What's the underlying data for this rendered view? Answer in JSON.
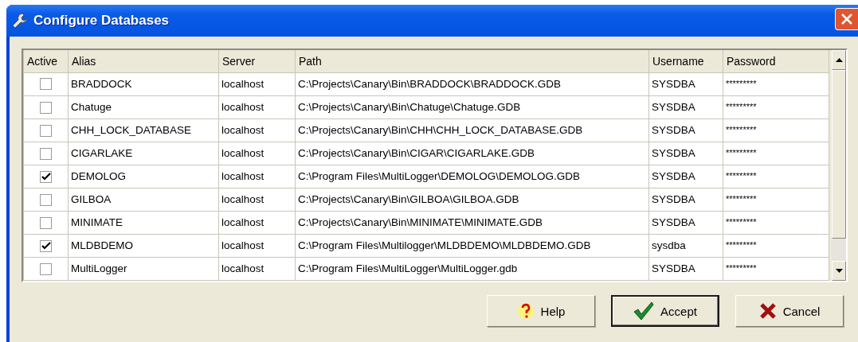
{
  "window": {
    "title": "Configure Databases"
  },
  "table": {
    "columns": [
      "Active",
      "Alias",
      "Server",
      "Path",
      "Username",
      "Password"
    ],
    "rows": [
      {
        "active": false,
        "alias": "BRADDOCK",
        "server": "localhost",
        "path": "C:\\Projects\\Canary\\Bin\\BRADDOCK\\BRADDOCK.GDB",
        "username": "SYSDBA",
        "password": "*********"
      },
      {
        "active": false,
        "alias": "Chatuge",
        "server": "localhost",
        "path": "C:\\Projects\\Canary\\Bin\\Chatuge\\Chatuge.GDB",
        "username": "SYSDBA",
        "password": "*********"
      },
      {
        "active": false,
        "alias": "CHH_LOCK_DATABASE",
        "server": "localhost",
        "path": "C:\\Projects\\Canary\\Bin\\CHH\\CHH_LOCK_DATABASE.GDB",
        "username": "SYSDBA",
        "password": "*********"
      },
      {
        "active": false,
        "alias": "CIGARLAKE",
        "server": "localhost",
        "path": "C:\\Projects\\Canary\\Bin\\CIGAR\\CIGARLAKE.GDB",
        "username": "SYSDBA",
        "password": "*********"
      },
      {
        "active": true,
        "alias": "DEMOLOG",
        "server": "localhost",
        "path": "C:\\Program Files\\MultiLogger\\DEMOLOG\\DEMOLOG.GDB",
        "username": "SYSDBA",
        "password": "*********"
      },
      {
        "active": false,
        "alias": "GILBOA",
        "server": "localhost",
        "path": "C:\\Projects\\Canary\\Bin\\GILBOA\\GILBOA.GDB",
        "username": "SYSDBA",
        "password": "*********"
      },
      {
        "active": false,
        "alias": "MINIMATE",
        "server": "localhost",
        "path": "C:\\Projects\\Canary\\Bin\\MINIMATE\\MINIMATE.GDB",
        "username": "SYSDBA",
        "password": "*********"
      },
      {
        "active": true,
        "alias": "MLDBDEMO",
        "server": "localhost",
        "path": "C:\\Program Files\\Multilogger\\MLDBDEMO\\MLDBDEMO.GDB",
        "username": "sysdba",
        "password": "*********"
      },
      {
        "active": false,
        "alias": "MultiLogger",
        "server": "localhost",
        "path": "C:\\Program Files\\MultiLogger\\MultiLogger.gdb",
        "username": "SYSDBA",
        "password": "*********"
      }
    ]
  },
  "buttons": [
    {
      "kind": "help",
      "label": "Help",
      "default": false
    },
    {
      "kind": "accept",
      "label": "Accept",
      "default": true
    },
    {
      "kind": "cancel",
      "label": "Cancel",
      "default": false
    }
  ]
}
